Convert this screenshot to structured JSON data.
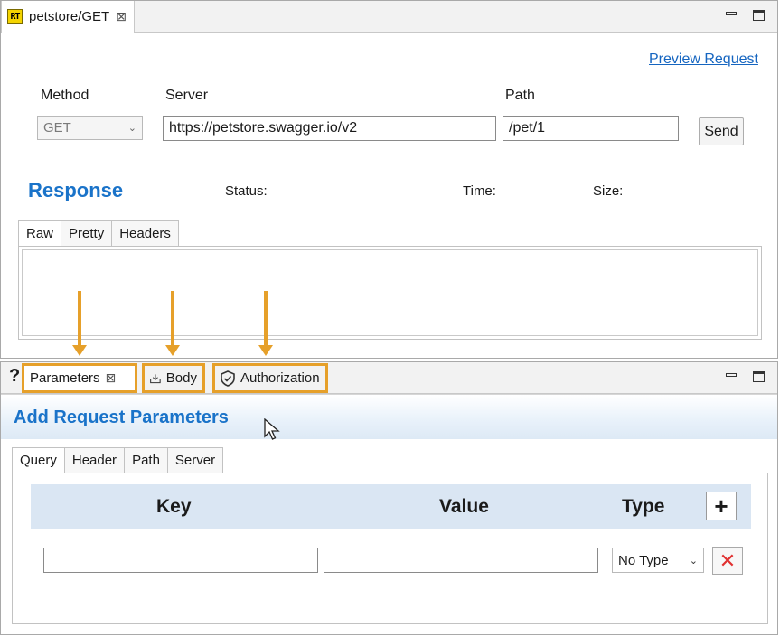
{
  "editor": {
    "tab_icon_text": "RT",
    "tab_title": "petstore/GET",
    "close_glyph": "⊠",
    "preview_link": "Preview Request",
    "method_label": "Method",
    "server_label": "Server",
    "path_label": "Path",
    "method_value": "GET",
    "server_value": "https://petstore.swagger.io/v2",
    "path_value": "/pet/1",
    "send_label": "Send",
    "response_title": "Response",
    "status_label": "Status:",
    "time_label": "Time:",
    "size_label": "Size:",
    "response_tabs": [
      "Raw",
      "Pretty",
      "Headers"
    ]
  },
  "view": {
    "help_glyph": "?",
    "tabs": {
      "parameters": "Parameters",
      "body": "Body",
      "authorization": "Authorization"
    },
    "title": "Add Request Parameters",
    "param_tabs": [
      "Query",
      "Header",
      "Path",
      "Server"
    ],
    "columns": {
      "key": "Key",
      "value": "Value",
      "type": "Type"
    },
    "add_glyph": "+",
    "row": {
      "key": "",
      "value": "",
      "type": "No Type",
      "delete_glyph": "✕"
    }
  },
  "icons": {
    "tab_icon": "rt-app-icon",
    "minimize": "minimize-icon",
    "maximize": "maximize-icon",
    "body": "body-upload-icon",
    "authorization": "shield-check-icon",
    "cursor": "mouse-pointer-icon"
  },
  "colors": {
    "accent_blue": "#1a73c9",
    "highlight_orange": "#e6a02a",
    "delete_red": "#e03030",
    "grid_header": "#dae6f3"
  }
}
